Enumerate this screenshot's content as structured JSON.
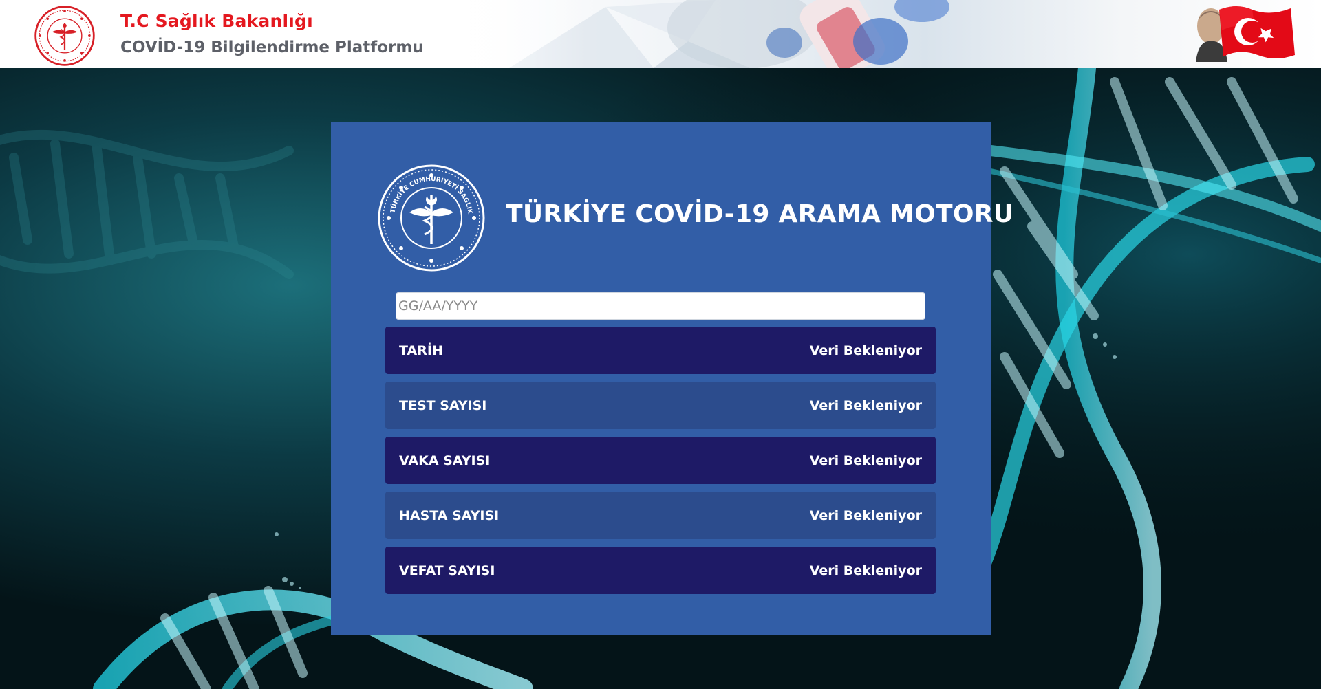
{
  "header": {
    "title": "T.C Sağlık Bakanlığı",
    "subtitle": "COVİD-19 Bilgilendirme Platformu",
    "logo_icon": "ministry-of-health-seal-icon",
    "flag_icon": "turkish-flag-icon"
  },
  "main": {
    "title": "TÜRKİYE COVİD-19 ARAMA MOTORU",
    "seal_icon": "ministry-of-health-seal-icon",
    "seal_text": "TÜRKİYE CUMHURİYETİ SAĞLIK BAKANLIĞI",
    "date_input": {
      "placeholder": "GG/AA/YYYY",
      "value": ""
    },
    "rows": [
      {
        "label": "TARİH",
        "value": "Veri Bekleniyor"
      },
      {
        "label": "TEST SAYISI",
        "value": "Veri Bekleniyor"
      },
      {
        "label": "VAKA SAYISI",
        "value": "Veri Bekleniyor"
      },
      {
        "label": "HASTA SAYISI",
        "value": "Veri Bekleniyor"
      },
      {
        "label": "VEFAT SAYISI",
        "value": "Veri Bekleniyor"
      }
    ]
  },
  "colors": {
    "brand_red": "#e4181f",
    "card_bg": "#325ea7",
    "row_dark": "#1e1a66",
    "row_mid": "#2c4c8d",
    "background": "#04161c",
    "dna_cyan": "#2fd8e8"
  }
}
